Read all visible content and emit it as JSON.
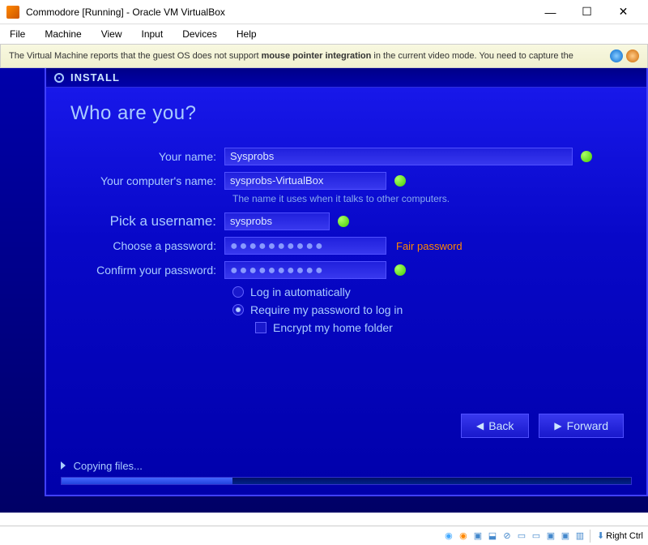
{
  "window": {
    "title": "Commodore [Running] - Oracle VM VirtualBox",
    "controls": {
      "min": "—",
      "max": "☐",
      "close": "✕"
    }
  },
  "menubar": [
    "File",
    "Machine",
    "View",
    "Input",
    "Devices",
    "Help"
  ],
  "infobar": {
    "prefix": "The Virtual Machine reports that the guest OS does not support ",
    "bold": "mouse pointer integration",
    "suffix": " in the current video mode. You need to capture the"
  },
  "installer": {
    "header": "INSTALL",
    "heading": "Who are you?",
    "form": {
      "name_label": "Your name:",
      "name_value": "Sysprobs",
      "computer_label": "Your computer's name:",
      "computer_value": "sysprobs-VirtualBox",
      "computer_hint": "The name it uses when it talks to other computers.",
      "username_label": "Pick a username:",
      "username_value": "sysprobs",
      "password_label": "Choose a password:",
      "password_value": "●●●●●●●●●●",
      "password_strength": "Fair password",
      "confirm_label": "Confirm your password:",
      "confirm_value": "●●●●●●●●●●",
      "auto_login": "Log in automatically",
      "require_pw": "Require my password to log in",
      "encrypt": "Encrypt my home folder"
    },
    "buttons": {
      "back": "Back",
      "forward": "Forward"
    },
    "progress": {
      "label": "Copying files...",
      "percent": 30
    }
  },
  "statusbar": {
    "host_key": "Right Ctrl"
  }
}
